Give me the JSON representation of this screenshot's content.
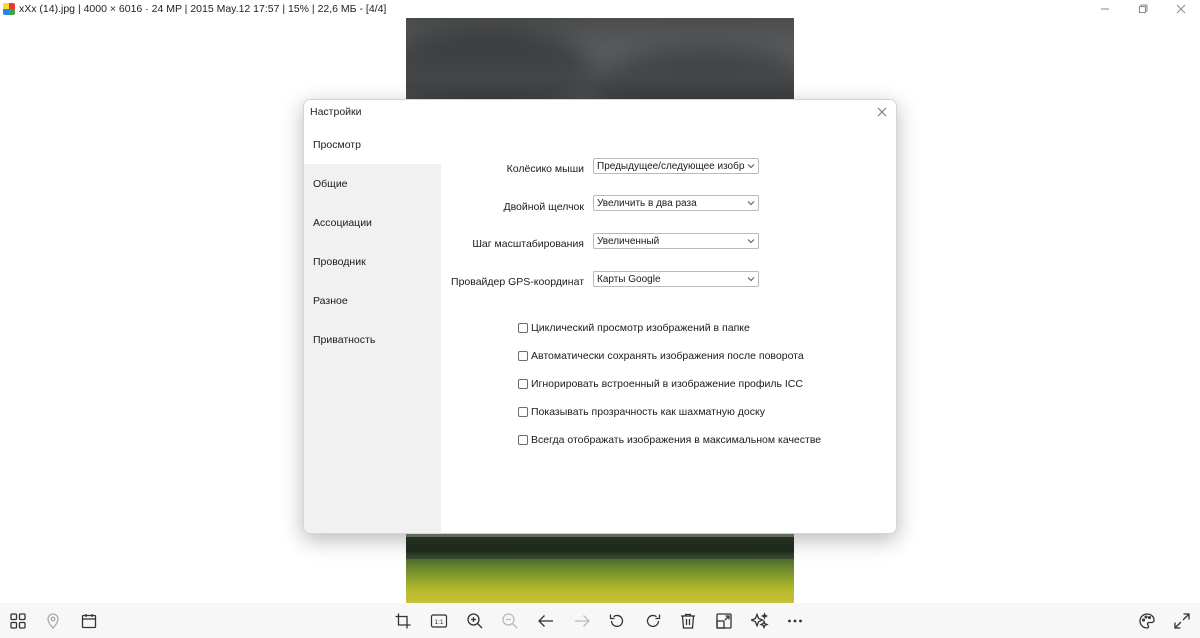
{
  "window": {
    "title": "xXx (14).jpg  |  4000 × 6016  ·  24 MP  |  2015 May.12 17:57  |  15%  |  22,6 МБ  -  [4/4]",
    "controls": [
      {
        "name": "minimize-icon"
      },
      {
        "name": "restore-icon"
      },
      {
        "name": "close-icon"
      }
    ]
  },
  "dialog": {
    "title": "Настройки",
    "sidebar": [
      {
        "label": "Просмотр",
        "active": true
      },
      {
        "label": "Общие",
        "active": false
      },
      {
        "label": "Ассоциации",
        "active": false
      },
      {
        "label": "Проводник",
        "active": false
      },
      {
        "label": "Разное",
        "active": false
      },
      {
        "label": "Приватность",
        "active": false
      }
    ],
    "fields": [
      {
        "label": "Колёсико мыши",
        "value": "Предыдущее/следующее изображение"
      },
      {
        "label": "Двойной щелчок",
        "value": "Увеличить в два раза"
      },
      {
        "label": "Шаг масштабирования",
        "value": "Увеличенный"
      },
      {
        "label": "Провайдер GPS-координат",
        "value": "Карты Google"
      }
    ],
    "checkboxes": [
      {
        "label": "Циклический просмотр изображений в папке",
        "checked": false
      },
      {
        "label": "Автоматически сохранять изображения после поворота",
        "checked": false
      },
      {
        "label": "Игнорировать встроенный в изображение профиль ICC",
        "checked": false
      },
      {
        "label": "Показывать прозрачность как шахматную доску",
        "checked": false
      },
      {
        "label": "Всегда отображать изображения в максимальном качестве",
        "checked": false
      }
    ]
  },
  "toolbar": {
    "left": [
      {
        "icon": "grid-icon",
        "enabled": true
      },
      {
        "icon": "location-pin-icon",
        "enabled": false
      },
      {
        "icon": "calendar-icon",
        "enabled": true
      }
    ],
    "center": [
      {
        "icon": "crop-icon",
        "enabled": true
      },
      {
        "icon": "actual-size-icon",
        "label": "1:1",
        "enabled": true
      },
      {
        "icon": "zoom-in-icon",
        "enabled": true
      },
      {
        "icon": "zoom-out-icon",
        "enabled": false
      },
      {
        "icon": "arrow-left-icon",
        "enabled": true
      },
      {
        "icon": "arrow-right-icon",
        "enabled": false
      },
      {
        "icon": "rotate-left-icon",
        "enabled": true
      },
      {
        "icon": "rotate-right-icon",
        "enabled": true
      },
      {
        "icon": "trash-icon",
        "enabled": true
      },
      {
        "icon": "resize-icon",
        "enabled": true
      },
      {
        "icon": "enhance-icon",
        "enabled": true
      },
      {
        "icon": "more-icon",
        "enabled": true
      }
    ],
    "right": [
      {
        "icon": "palette-icon",
        "enabled": true
      },
      {
        "icon": "fullscreen-icon",
        "enabled": true
      }
    ]
  }
}
